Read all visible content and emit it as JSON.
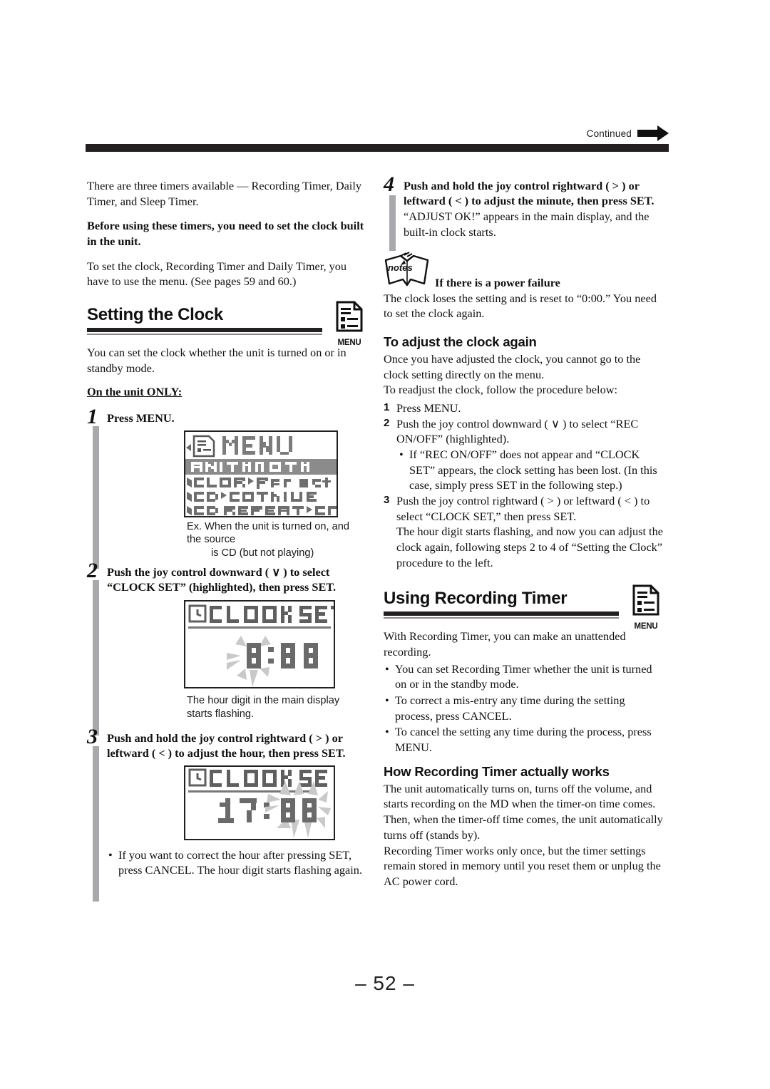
{
  "header": {
    "continued_label": "Continued",
    "arrow_icon": "right-arrow-icon"
  },
  "page_number": "– 52 –",
  "left_column": {
    "intro_paragraph": "There are three timers available — Recording Timer, Daily Timer, and Sleep Timer.",
    "intro_bold": "Before using these timers, you need to set the clock built in the unit.",
    "intro_paragraph_2": "To set the clock, Recording Timer and Daily Timer, you have to use the menu. (See pages 59 and 60.)",
    "section": {
      "title": "Setting the Clock",
      "menu_icon_label": "MENU",
      "menu_icon": "menu-document-icon"
    },
    "section_intro": "You can set the clock whether the unit is turned on or in standby mode.",
    "unit_only_head": "On the unit ONLY:",
    "steps": [
      {
        "number": "1",
        "title": "Press MENU.",
        "display": {
          "header_text": "MENU",
          "rows": [
            "ANIMATION",
            "◀COLOR▶Pre set",
            "◀CD▶CONTINUE",
            "◀CD REPEAT▶OFF"
          ],
          "highlighted_row": "ANIMATION"
        },
        "caption_line1": "Ex. When the unit is turned on, and the source",
        "caption_line2": "is CD (but not playing)"
      },
      {
        "number": "2",
        "title": "Push the joy control downward ( ∨ )  to select “CLOCK SET” (highlighted), then press SET.",
        "display": {
          "header_text": "CLOCK SET",
          "time": "0:00",
          "flashing": "hour"
        },
        "caption_line1": "The hour digit in the main display",
        "caption_line2": "starts flashing."
      },
      {
        "number": "3",
        "title": "Push and hold the joy control rightward ( > ) or leftward ( < ) to adjust the hour, then press SET.",
        "display": {
          "header_text": "CLOCK SET",
          "time": "17:00",
          "flashing": "minute"
        },
        "bullet": "If you want to correct the hour after pressing SET, press CANCEL. The hour digit starts flashing again."
      }
    ]
  },
  "right_column": {
    "step4": {
      "number": "4",
      "title": "Push and hold the joy control rightward ( > ) or leftward ( < ) to adjust the minute, then press SET.",
      "body": "“ADJUST OK!” appears in the main display, and the built-in clock starts."
    },
    "note": {
      "icon": "notes-book-icon",
      "icon_label": "notes",
      "title": "If there is a power failure",
      "body": "The clock loses the setting and is reset to “0:00.” You need to set the clock again."
    },
    "readjust": {
      "title": "To adjust the clock again",
      "body1": "Once you have adjusted the clock, you cannot go to the clock setting directly on the menu.",
      "body2": "To readjust the clock, follow the procedure below:",
      "steps": [
        {
          "number": "1",
          "text": "Press MENU."
        },
        {
          "number": "2",
          "text": "Push the joy control downward ( ∨ ) to select “REC ON/OFF” (highlighted).",
          "sub_bullet": "If “REC ON/OFF” does not appear and “CLOCK SET” appears, the clock setting has been lost. (In this case, simply press SET in the following step.)"
        },
        {
          "number": "3",
          "text": "Push the joy control rightward ( > ) or leftward ( < ) to select “CLOCK SET,” then press SET.",
          "extra": "The hour digit starts flashing, and now you can adjust the clock again, following steps 2 to 4 of “Setting the Clock” procedure to the left."
        }
      ]
    },
    "recording_timer_section": {
      "title": "Using Recording Timer",
      "menu_icon_label": "MENU",
      "menu_icon": "menu-document-icon",
      "intro": "With Recording Timer, you can make an unattended recording.",
      "bullets": [
        "You can set Recording Timer whether the unit is turned on or in the standby mode.",
        "To correct a mis-entry any time during the setting process, press CANCEL.",
        "To cancel the setting any time during the process, press MENU."
      ]
    },
    "how_works": {
      "title": "How Recording Timer actually works",
      "para1": "The unit automatically turns on, turns off the volume, and starts recording on the MD when the timer-on time comes. Then, when the timer-off time comes, the unit automatically turns off (stands by).",
      "para2": "Recording Timer works only once, but the timer settings remain stored in memory until you reset them or unplug the AC power cord."
    }
  }
}
